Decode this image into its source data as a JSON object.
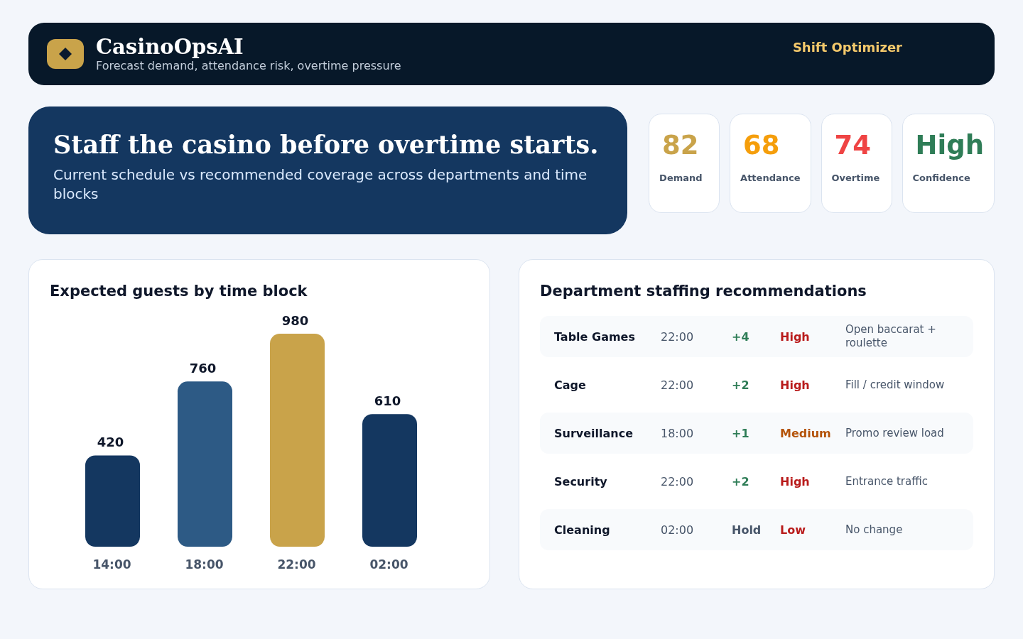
{
  "header": {
    "title": "CasinoOpsAI",
    "subtitle": "Forecast demand, attendance risk, overtime pressure",
    "mode": "Shift Optimizer"
  },
  "hero": {
    "heading": "Staff the casino before overtime starts.",
    "subtitle": "Current schedule vs recommended coverage across departments and time blocks"
  },
  "metrics": [
    {
      "value": "82",
      "label": "Demand",
      "color": "#c9a34a"
    },
    {
      "value": "68",
      "label": "Attendance",
      "color": "#f59e0b"
    },
    {
      "value": "74",
      "label": "Overtime",
      "color": "#ef4444"
    },
    {
      "value": "High",
      "label": "Confidence",
      "color": "#2f7d57"
    }
  ],
  "guest_chart": {
    "chart_data": {
      "type": "bar",
      "title": "Expected guests by time block",
      "categories": [
        "14:00",
        "18:00",
        "22:00",
        "02:00"
      ],
      "values": [
        420,
        760,
        980,
        610
      ],
      "data_labels": true
    }
  },
  "staffing": {
    "title": "Department staffing recommendations",
    "rows": [
      {
        "department": "Table Games",
        "time": "22:00",
        "change": {
          "text": "+4",
          "kind": "increase"
        },
        "priority": {
          "text": "High",
          "color": "#b91c1c"
        },
        "note": "Open baccarat + roulette"
      },
      {
        "department": "Cage",
        "time": "22:00",
        "change": {
          "text": "+2",
          "kind": "increase"
        },
        "priority": {
          "text": "High",
          "color": "#b91c1c"
        },
        "note": "Fill / credit window"
      },
      {
        "department": "Surveillance",
        "time": "18:00",
        "change": {
          "text": "+1",
          "kind": "increase"
        },
        "priority": {
          "text": "Medium",
          "color": "#b45309"
        },
        "note": "Promo review load"
      },
      {
        "department": "Security",
        "time": "22:00",
        "change": {
          "text": "+2",
          "kind": "increase"
        },
        "priority": {
          "text": "High",
          "color": "#b91c1c"
        },
        "note": "Entrance traffic"
      },
      {
        "department": "Cleaning",
        "time": "02:00",
        "change": {
          "text": "Hold",
          "kind": "hold"
        },
        "priority": {
          "text": "Low",
          "color": "#b91c1c"
        },
        "note": "No change"
      }
    ]
  }
}
